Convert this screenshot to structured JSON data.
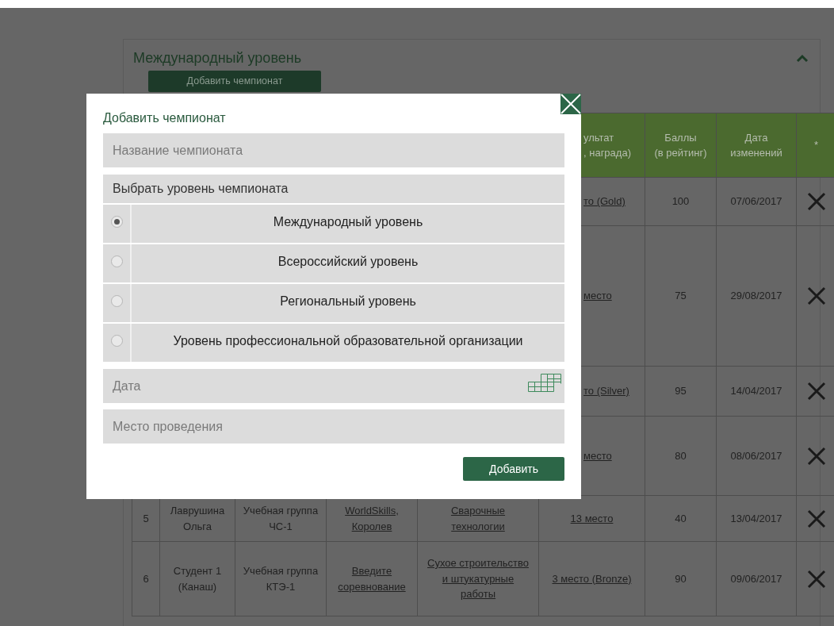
{
  "panel": {
    "title": "Международный уровень",
    "add_button": "Добавить чемпионат",
    "expanded": true
  },
  "table": {
    "columns": [
      {
        "label": "ультат\n, награда)"
      },
      {
        "label": "Баллы\n(в рейтинг)"
      },
      {
        "label": "Дата\nизменений"
      },
      {
        "label": "*"
      }
    ],
    "rows": [
      {
        "result": "то (Gold)",
        "points": "100",
        "date": "07/06/2017"
      },
      {
        "result": "место",
        "points": "75",
        "date": "29/08/2017"
      },
      {
        "result": "то (Silver)",
        "points": "95",
        "date": "14/04/2017"
      },
      {
        "result": "место",
        "points": "80",
        "date": "08/06/2017"
      },
      {
        "number": "5",
        "student": "Лаврушина Ольга",
        "group": "Учебная группа ЧС-1",
        "competition": "WorldSkills, Королев",
        "skill": "Сварочные технологии",
        "result": "13 место",
        "points": "40",
        "date": "13/04/2017"
      },
      {
        "number": "6",
        "student": "Студент 1 (Канаш)",
        "group": "Учебная группа КТЭ-1",
        "competition": "Введите соревнование",
        "skill": "Сухое строительство и штукатурные работы",
        "result": "3 место (Bronze)",
        "points": "90",
        "date": "09/06/2017"
      }
    ]
  },
  "modal": {
    "title": "Добавить чемпионат",
    "name_placeholder": "Название чемпионата",
    "level_label": "Выбрать уровень чемпионата",
    "levels": [
      {
        "label": "Международный уровень",
        "selected": true
      },
      {
        "label": "Всероссийский уровень",
        "selected": false
      },
      {
        "label": "Региональный уровень",
        "selected": false
      },
      {
        "label": "Уровень профессиональной образовательной организации",
        "selected": false
      }
    ],
    "date_placeholder": "Дата",
    "place_placeholder": "Место проведения",
    "submit": "Добавить"
  }
}
